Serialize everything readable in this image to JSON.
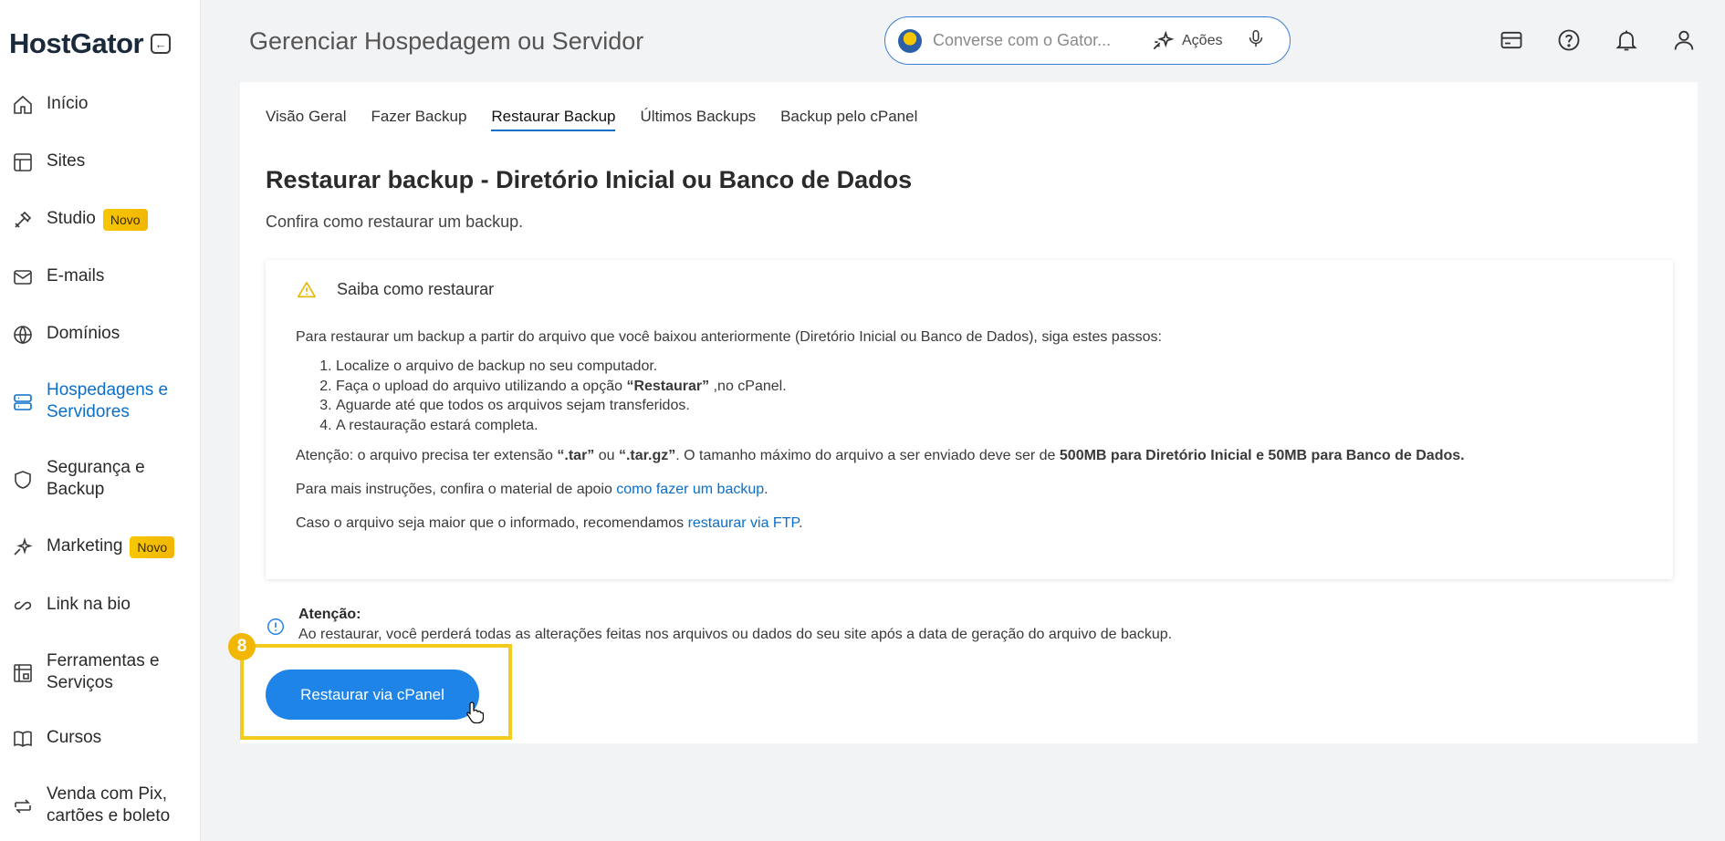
{
  "sidebar": {
    "logo": "HostGator",
    "items": [
      {
        "label": "Início",
        "icon": "home-icon"
      },
      {
        "label": "Sites",
        "icon": "layout-icon"
      },
      {
        "label": "Studio",
        "icon": "studio-icon",
        "badge": "Novo"
      },
      {
        "label": "E-mails",
        "icon": "mail-icon"
      },
      {
        "label": "Domínios",
        "icon": "globe-icon"
      },
      {
        "label": "Hospedagens e Servidores",
        "icon": "server-icon",
        "active": true
      },
      {
        "label": "Segurança e Backup",
        "icon": "shield-icon"
      },
      {
        "label": "Marketing",
        "icon": "sparkle-icon",
        "badge": "Novo"
      },
      {
        "label": "Link na bio",
        "icon": "link-icon"
      },
      {
        "label": "Ferramentas e Serviços",
        "icon": "tools-icon"
      },
      {
        "label": "Cursos",
        "icon": "book-icon"
      },
      {
        "label": "Venda com Pix, cartões e boleto",
        "icon": "exchange-icon"
      }
    ]
  },
  "header": {
    "title": "Gerenciar Hospedagem ou Servidor",
    "search_placeholder": "Converse com o Gator...",
    "actions_label": "Ações"
  },
  "tabs": [
    "Visão Geral",
    "Fazer Backup",
    "Restaurar Backup",
    "Últimos Backups",
    "Backup pelo cPanel"
  ],
  "active_tab": "Restaurar Backup",
  "main": {
    "heading": "Restaurar backup - Diretório Inicial ou Banco de Dados",
    "subtitle": "Confira como restaurar um backup.",
    "box_title": "Saiba como restaurar",
    "intro": "Para restaurar um backup a partir do arquivo que você baixou anteriormente (Diretório Inicial ou Banco de Dados), siga estes passos:",
    "steps": {
      "s1": "Localize o arquivo de backup no seu computador.",
      "s2_pre": "Faça o upload do arquivo utilizando a opção ",
      "s2_bold": "“Restaurar”",
      "s2_post": " ,no cPanel.",
      "s3": "Aguarde até que todos os arquivos sejam transferidos.",
      "s4": "A restauração estará completa."
    },
    "note_pre": "Atenção: o arquivo precisa ter extensão ",
    "note_tar": "“.tar”",
    "note_or": " ou ",
    "note_targz": "“.tar.gz”",
    "note_mid": ". O tamanho máximo do arquivo a ser enviado deve ser de ",
    "note_bold": "500MB para Diretório Inicial e 50MB para Banco de Dados.",
    "more_pre": "Para mais instruções, confira o material de apoio ",
    "more_link": "como fazer um backup",
    "more_post": ".",
    "ftp_pre": "Caso o arquivo seja maior que o informado, recomendamos ",
    "ftp_link": "restaurar via FTP",
    "ftp_post": ".",
    "attention_title": "Atenção:",
    "attention_text": "Ao restaurar, você perderá todas as alterações feitas nos arquivos ou dados do seu site após a data de geração do arquivo de backup.",
    "cta": "Restaurar via cPanel",
    "step_number": "8"
  },
  "colors": {
    "accent": "#0b6fc9",
    "cta": "#1f84e7",
    "highlight": "#f2cb1d",
    "badge": "#f6c700"
  }
}
